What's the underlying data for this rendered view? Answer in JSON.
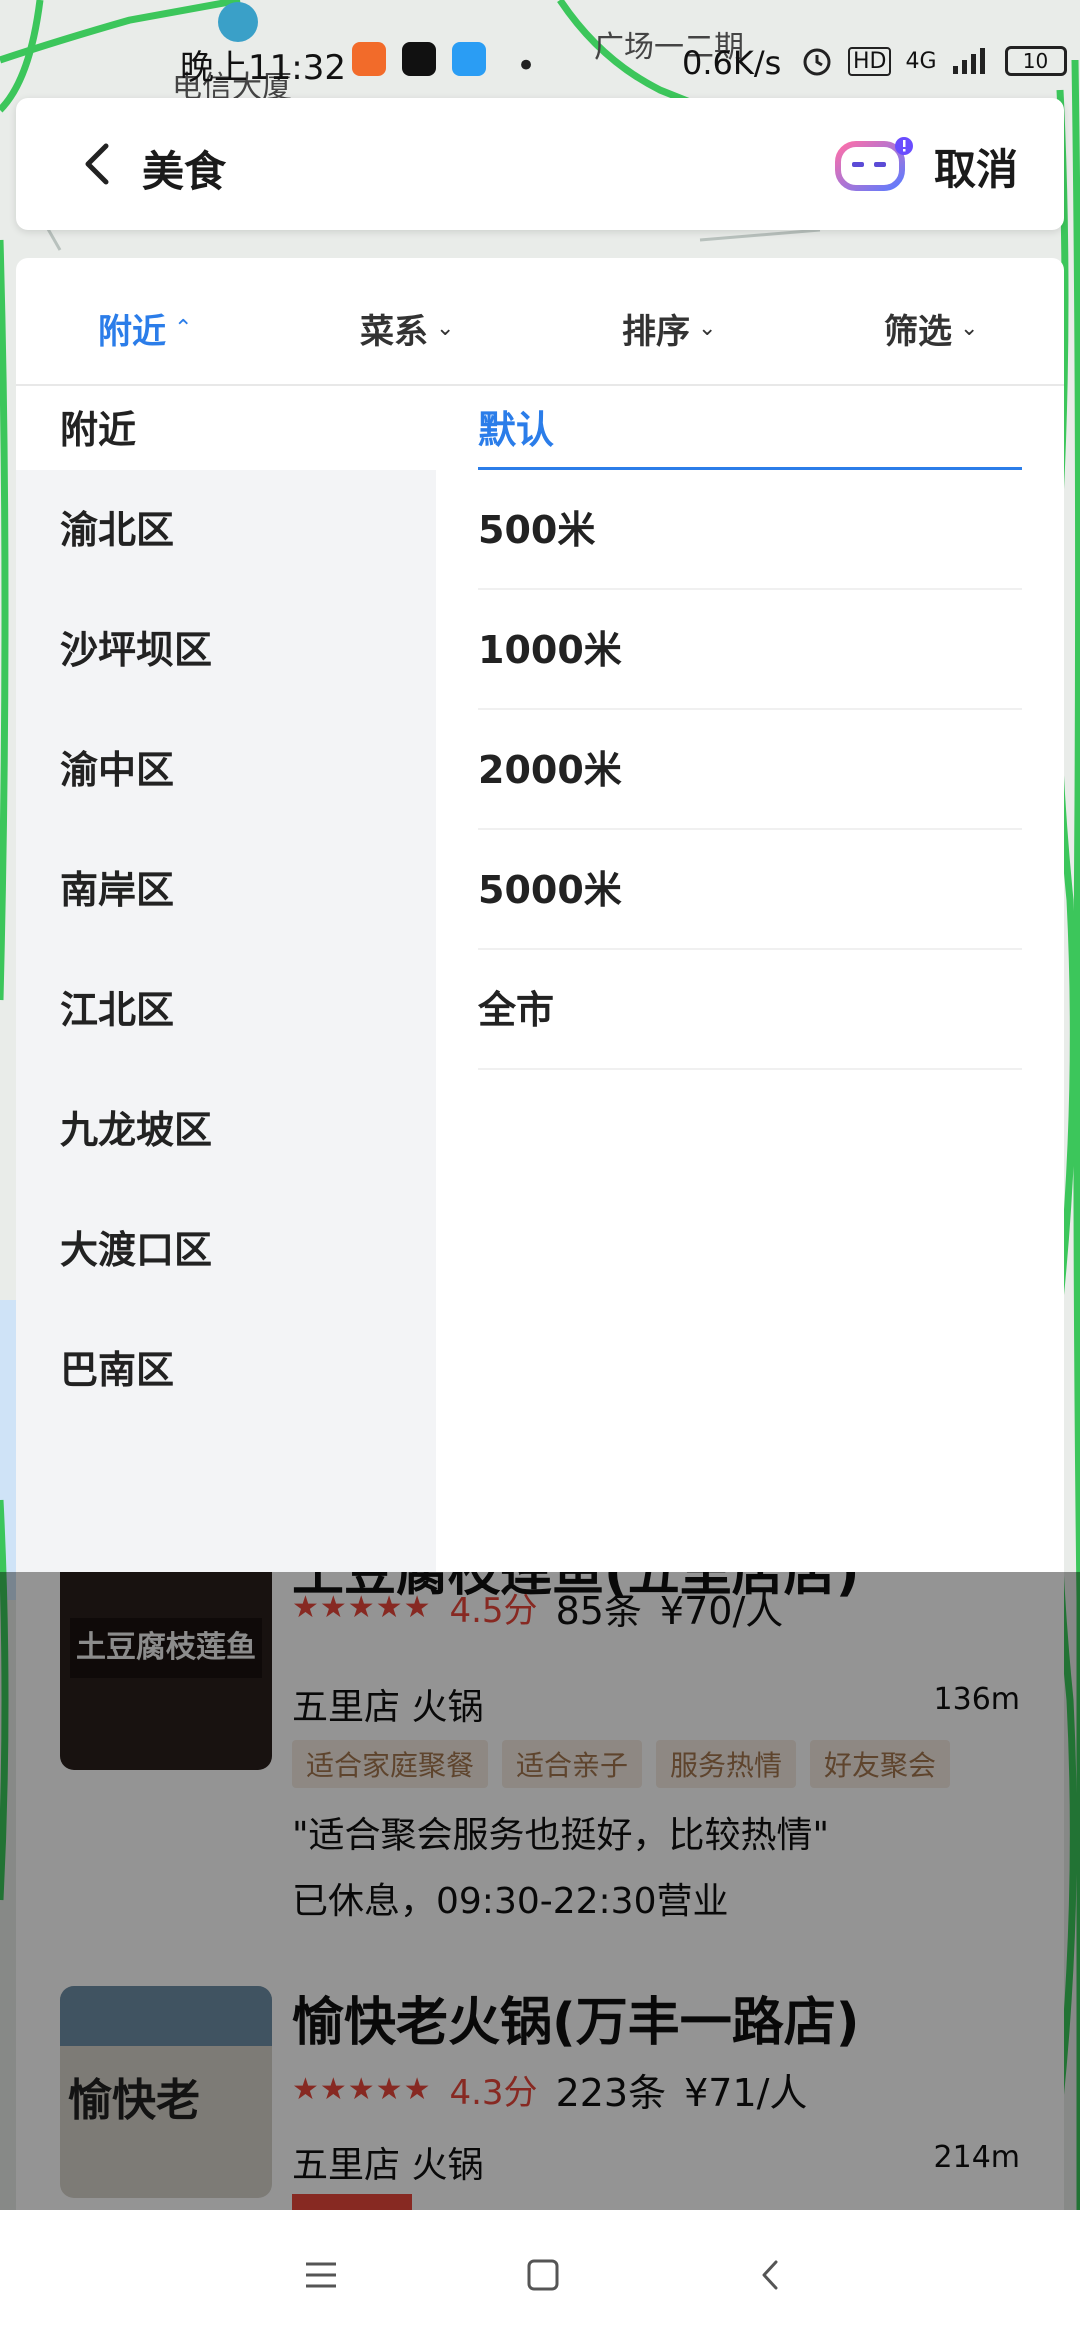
{
  "map": {
    "labels": [
      "电信大厦",
      "广场一二期"
    ]
  },
  "status_bar": {
    "time": "晚上11:32",
    "dot": "•",
    "speed": "0.6K/s",
    "hd": "HD",
    "network": "4G",
    "battery": "10"
  },
  "header": {
    "title": "美食",
    "cancel_label": "取消"
  },
  "filter_tabs": [
    {
      "label": "附近",
      "active": true
    },
    {
      "label": "菜系",
      "active": false
    },
    {
      "label": "排序",
      "active": false
    },
    {
      "label": "筛选",
      "active": false
    }
  ],
  "districts": [
    "附近",
    "渝北区",
    "沙坪坝区",
    "渝中区",
    "南岸区",
    "江北区",
    "九龙坡区",
    "大渡口区",
    "巴南区"
  ],
  "distances": [
    "默认",
    "500米",
    "1000米",
    "2000米",
    "5000米",
    "全市"
  ],
  "results": [
    {
      "name": "土豆腐枝莲鱼(五里店店)",
      "thumb_text": "土豆腐枝莲鱼",
      "stars": "★★★★★",
      "score": "4.5分",
      "count": "85条",
      "price": "¥70/人",
      "area": "五里店 火锅",
      "distance": "136m",
      "tags": [
        "适合家庭聚餐",
        "适合亲子",
        "服务热情",
        "好友聚会"
      ],
      "quote": "\"适合聚会服务也挺好，比较热情\"",
      "hours": "已休息，09:30-22:30营业"
    },
    {
      "name": "愉快老火锅(万丰一路店)",
      "thumb_text": "愉快老",
      "stars": "★★★★★",
      "score": "4.3分",
      "count": "223条",
      "price": "¥71/人",
      "area": "五里店 火锅",
      "distance": "214m"
    }
  ],
  "colors": {
    "accent": "#2b7de9",
    "rating": "#e8483b",
    "tag_bg": "#f5ebe2",
    "tag_text": "#a3764f"
  }
}
